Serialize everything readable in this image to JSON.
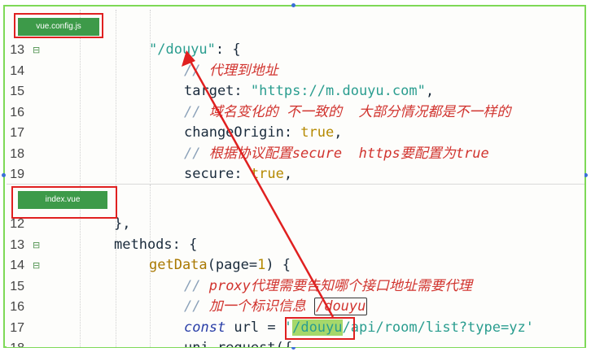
{
  "tabs": {
    "top": "vue.config.js",
    "bottom": "index.vue"
  },
  "top_pane": {
    "lines": [
      {
        "num": "13",
        "fold": "⊟",
        "parts": [
          {
            "t": "\"/douyu\"",
            "c": "str"
          },
          {
            "t": ": {",
            "c": "plain"
          }
        ]
      },
      {
        "num": "14",
        "fold": "",
        "parts": [
          {
            "t": "// ",
            "c": "cmt-mk"
          },
          {
            "t": "代理到地址",
            "c": "cmt"
          }
        ]
      },
      {
        "num": "15",
        "fold": "",
        "parts": [
          {
            "t": "target: ",
            "c": "key"
          },
          {
            "t": "\"https://m.douyu.com\"",
            "c": "str"
          },
          {
            "t": ",",
            "c": "plain"
          }
        ]
      },
      {
        "num": "16",
        "fold": "",
        "parts": [
          {
            "t": "// ",
            "c": "cmt-mk"
          },
          {
            "t": "域名变化的 不一致的  大部分情况都是不一样的",
            "c": "cmt"
          }
        ]
      },
      {
        "num": "17",
        "fold": "",
        "parts": [
          {
            "t": "changeOrigin: ",
            "c": "key"
          },
          {
            "t": "true",
            "c": "bool"
          },
          {
            "t": ",",
            "c": "plain"
          }
        ]
      },
      {
        "num": "18",
        "fold": "",
        "parts": [
          {
            "t": "// ",
            "c": "cmt-mk"
          },
          {
            "t": "根据协议配置secure  https要配置为true",
            "c": "cmt"
          }
        ]
      },
      {
        "num": "19",
        "fold": "",
        "parts": [
          {
            "t": "secure: ",
            "c": "key"
          },
          {
            "t": "true",
            "c": "bool"
          },
          {
            "t": ",",
            "c": "plain"
          }
        ]
      }
    ]
  },
  "bottom_pane": {
    "lines": [
      {
        "num": "12",
        "fold": "",
        "parts": [
          {
            "t": "},",
            "c": "plain"
          }
        ]
      },
      {
        "num": "13",
        "fold": "⊟",
        "parts": [
          {
            "t": "methods: {",
            "c": "plain"
          }
        ]
      },
      {
        "num": "14",
        "fold": "⊟",
        "parts": [
          {
            "t": "getData",
            "c": "fn"
          },
          {
            "t": "(page=",
            "c": "plain"
          },
          {
            "t": "1",
            "c": "num"
          },
          {
            "t": ") {",
            "c": "plain"
          }
        ]
      },
      {
        "num": "15",
        "fold": "",
        "parts": [
          {
            "t": "// ",
            "c": "cmt-mk"
          },
          {
            "t": "proxy代理需要告知哪个接口地址需要代理",
            "c": "cmt"
          }
        ]
      },
      {
        "num": "16",
        "fold": "",
        "parts": [
          {
            "t": "// ",
            "c": "cmt-mk"
          },
          {
            "t": "加一个标识信息 ",
            "c": "cmt"
          },
          {
            "t": "/douyu",
            "c": "cmt boxed"
          }
        ]
      },
      {
        "num": "17",
        "fold": "",
        "parts": [
          {
            "t": "const",
            "c": "kw"
          },
          {
            "t": " url = ",
            "c": "plain"
          },
          {
            "t": "'",
            "c": "str"
          },
          {
            "t": "/douyu",
            "c": "str hl"
          },
          {
            "t": "/api/room/list?type=yz'",
            "c": "str"
          }
        ]
      },
      {
        "num": "18",
        "fold": "",
        "parts": [
          {
            "t": "uni.request({",
            "c": "plain"
          }
        ]
      }
    ]
  }
}
